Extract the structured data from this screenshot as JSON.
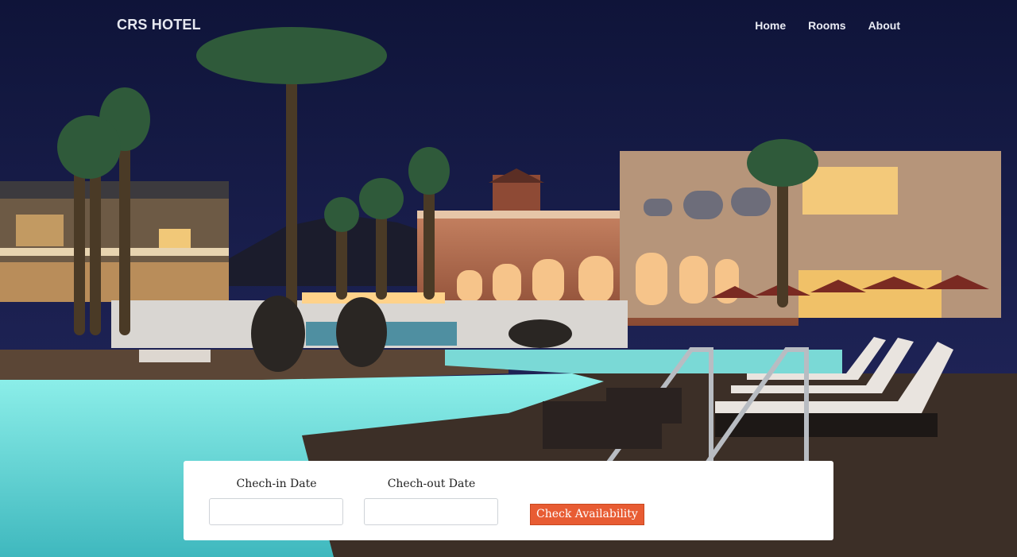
{
  "brand": {
    "name": "CRS HOTEL"
  },
  "nav": {
    "items": [
      "Home",
      "Rooms",
      "About"
    ]
  },
  "booking": {
    "checkin_label": "Chech-in Date",
    "checkout_label": "Chech-out Date",
    "checkin_value": "",
    "checkout_value": "",
    "button_label": "Check Availability"
  },
  "colors": {
    "accent": "#e85c33",
    "panel": "#ffffff",
    "sky": "#14183d",
    "pool": "#6fe3df"
  }
}
